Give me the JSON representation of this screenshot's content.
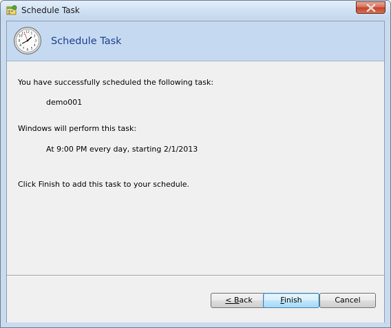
{
  "window": {
    "title": "Schedule Task",
    "close_label": "Close"
  },
  "header": {
    "title": "Schedule Task"
  },
  "content": {
    "success_text": "You have successfully scheduled the following task:",
    "task_name": "demo001",
    "perform_label": "Windows will perform this task:",
    "schedule": "At 9:00 PM every day, starting 2/1/2013",
    "finish_hint": "Click Finish to add this task to your schedule."
  },
  "buttons": {
    "back_mnemonic": "< B",
    "back_rest": "ack",
    "finish_mnemonic": "F",
    "finish_rest": "inish",
    "cancel": "Cancel"
  },
  "colors": {
    "header_background": "#c5daf1",
    "header_title": "#1e3f8f",
    "dialog_background": "#f0f0f0",
    "close_button": "#c2432c"
  },
  "icons": {
    "app": "scheduled-tasks-icon",
    "header": "clock-icon",
    "close": "close-icon"
  }
}
